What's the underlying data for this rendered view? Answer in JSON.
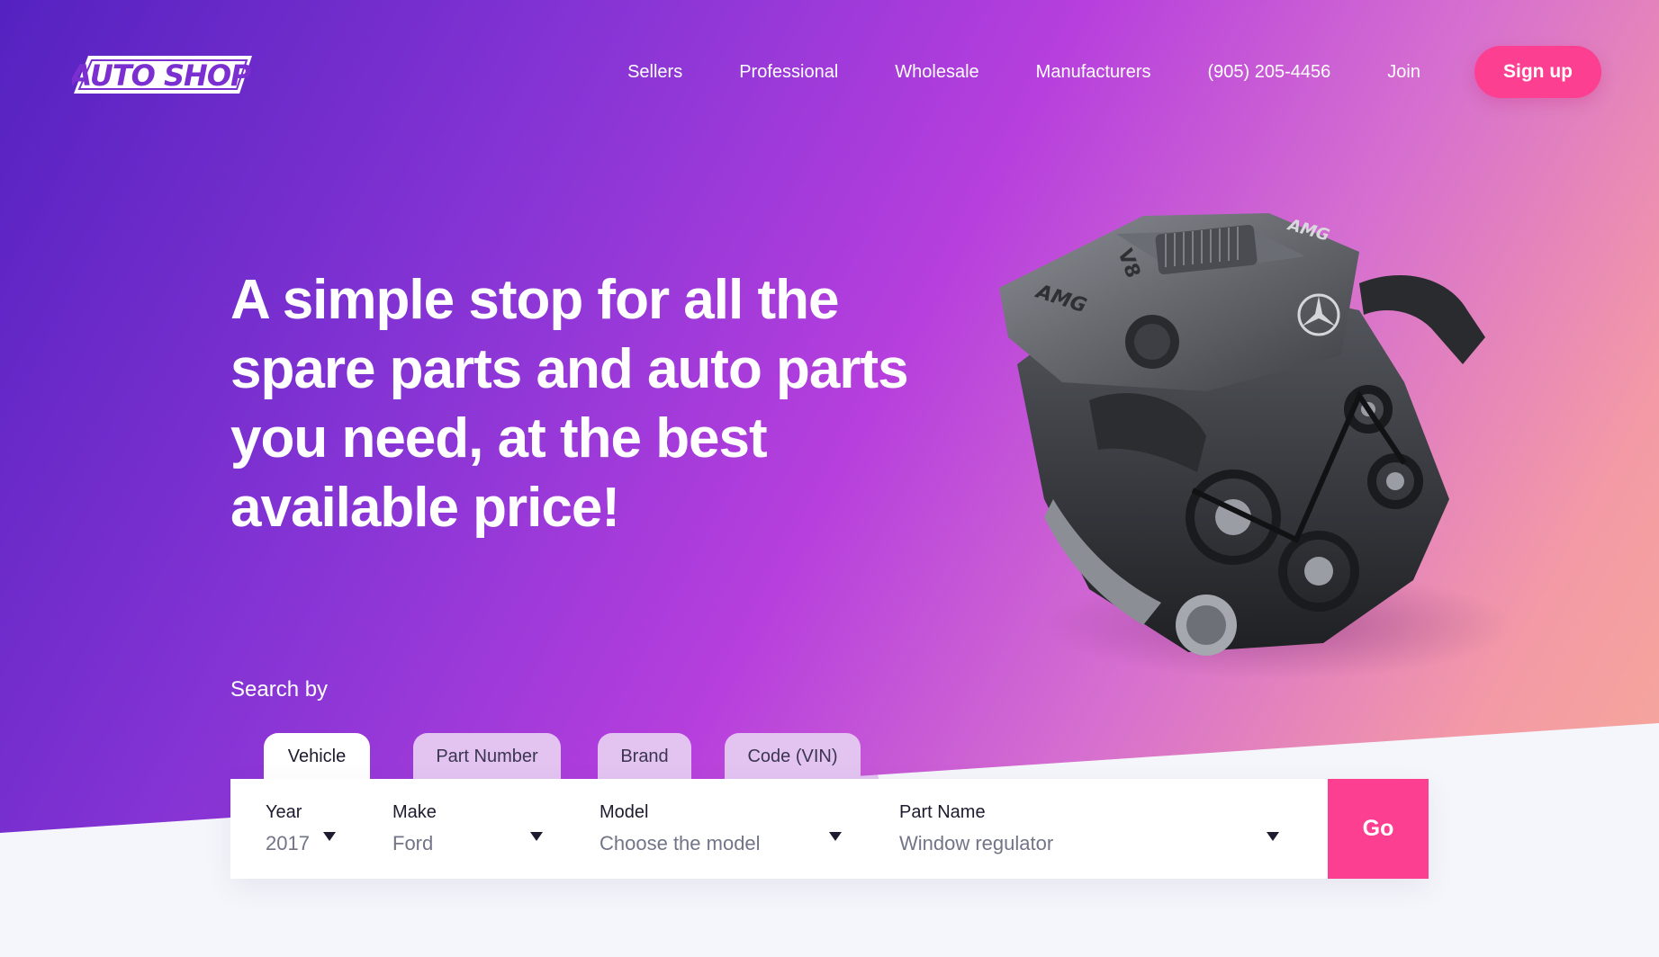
{
  "brand": {
    "logo_text": "AUTO SHOP"
  },
  "nav": {
    "links": [
      "Sellers",
      "Professional",
      "Wholesale",
      "Manufacturers"
    ],
    "phone": "(905) 205-4456",
    "join": "Join",
    "signup": "Sign up"
  },
  "hero": {
    "headline_lines": [
      "A simple stop for all the",
      "spare parts and auto parts",
      "you need, at the best",
      "available price!"
    ],
    "engine_badges": [
      "AMG",
      "V8",
      "AMG"
    ]
  },
  "search": {
    "label": "Search by",
    "tabs": [
      "Vehicle",
      "Part Number",
      "Brand",
      "Code (VIN)"
    ],
    "active_tab": "Vehicle",
    "fields": {
      "year": {
        "label": "Year",
        "value": "2017"
      },
      "make": {
        "label": "Make",
        "value": "Ford"
      },
      "model": {
        "label": "Model",
        "value": "Choose the model"
      },
      "part": {
        "label": "Part Name",
        "value": "Window regulator"
      }
    },
    "go": "Go"
  },
  "colors": {
    "accent": "#fd3f92",
    "gradient_start": "#5422c0",
    "gradient_end": "#f7ab96"
  }
}
